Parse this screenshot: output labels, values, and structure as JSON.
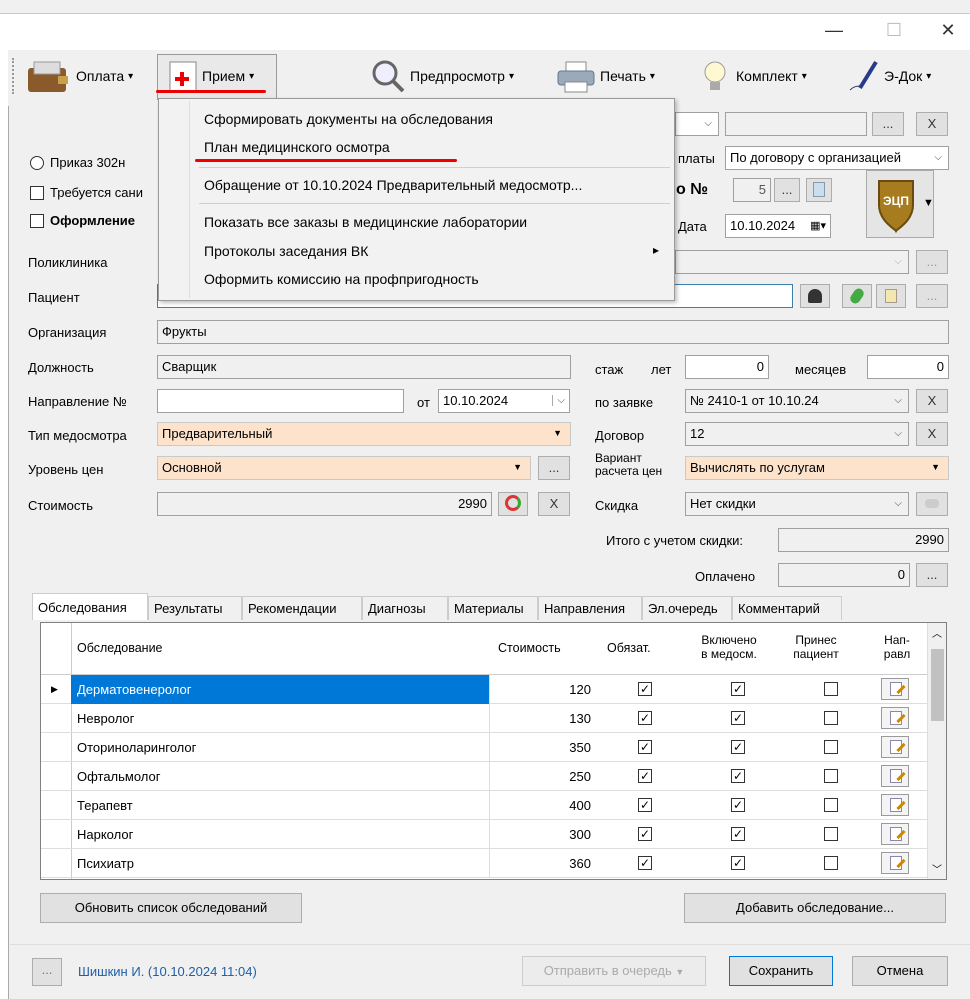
{
  "window": {
    "minimize": "—",
    "maximize": "☐",
    "close": "✕"
  },
  "toolbar": {
    "items": [
      {
        "label": "Оплата",
        "arrow": "▾"
      },
      {
        "label": "Прием",
        "arrow": "▾"
      },
      {
        "label": "Предпросмотр",
        "arrow": "▾"
      },
      {
        "label": "Печать",
        "arrow": "▾"
      },
      {
        "label": "Комплект",
        "arrow": "▾"
      },
      {
        "label": "Э-Док",
        "arrow": "▾"
      }
    ]
  },
  "menu": {
    "items": [
      "Сформировать документы на обследования",
      "План медицинского осмотра",
      "Обращение от 10.10.2024 Предварительный медосмотр...",
      "Показать все заказы в медицинские лаборатории",
      "Протоколы заседания ВК",
      "Оформить комиссию на профпригодность"
    ],
    "submenu_arrow": "▸"
  },
  "form": {
    "prikaz": "Приказ 302н",
    "trebuetsya": "Требуется сани",
    "oformlenie": "Оформление",
    "oplaty_label": "платы",
    "oplaty_value": "По договору с организацией",
    "no_label": "о №",
    "no_value": "5",
    "data_label": "Дата",
    "data_value": "10.10.2024",
    "badge": "ЭЦП",
    "poliklinika_label": "Поликлиника",
    "pacient_label": "Пациент",
    "organizaciya_label": "Организация",
    "organizaciya_value": "Фрукты",
    "dolzhnost_label": "Должность",
    "dolzhnost_value": "Сварщик",
    "stazh_label": "стаж",
    "let_label": "лет",
    "let_value": "0",
    "mesyacev_label": "месяцев",
    "mesyacev_value": "0",
    "napravlenie_label": "Направление №",
    "ot_label": "от",
    "ot_value": "10.10.2024",
    "po_zayavke_label": "по заявке",
    "po_zayavke_value": "№ 2410-1 от 10.10.24",
    "tip_label": "Тип медосмотра",
    "tip_value": "Предварительный",
    "dogovor_label": "Договор",
    "dogovor_value": "12",
    "uroven_label": "Уровень цен",
    "uroven_value": "Основной",
    "variant_label1": "Вариант",
    "variant_label2": "расчета цен",
    "variant_value": "Вычислять по услугам",
    "stoimost_label": "Стоимость",
    "stoimost_value": "2990",
    "skidka_label": "Скидка",
    "skidka_value": "Нет скидки",
    "itogo_label": "Итого с учетом скидки:",
    "itogo_value": "2990",
    "oplacheno_label": "Оплачено",
    "oplacheno_value": "0",
    "x": "X",
    "dots": "..."
  },
  "tabs": [
    "Обследования",
    "Результаты",
    "Рекомендации",
    "Диагнозы",
    "Материалы",
    "Направления",
    "Эл.очередь",
    "Комментарий"
  ],
  "grid": {
    "headers": {
      "name": "Обследование",
      "cost": "Стоимость",
      "oblig1": "Обязат.",
      "incl1": "Включено",
      "incl2": "в медосм.",
      "brought1": "Принес",
      "brought2": "пациент",
      "napr1": "Нап-",
      "napr2": "равл"
    },
    "rows": [
      {
        "name": "Дерматовенеролог",
        "cost": "120"
      },
      {
        "name": "Невролог",
        "cost": "130"
      },
      {
        "name": "Оториноларинголог",
        "cost": "350"
      },
      {
        "name": "Офтальмолог",
        "cost": "250"
      },
      {
        "name": "Терапевт",
        "cost": "400"
      },
      {
        "name": "Нарколог",
        "cost": "300"
      },
      {
        "name": "Психиатр",
        "cost": "360"
      }
    ],
    "check": "✓"
  },
  "buttons": {
    "refresh": "Обновить список обследований",
    "add": "Добавить обследование...",
    "queue": "Отправить в очередь",
    "save": "Сохранить",
    "cancel": "Отмена"
  },
  "footer": {
    "user": "Шишкин И. (10.10.2024 11:04)",
    "dots": "..."
  }
}
